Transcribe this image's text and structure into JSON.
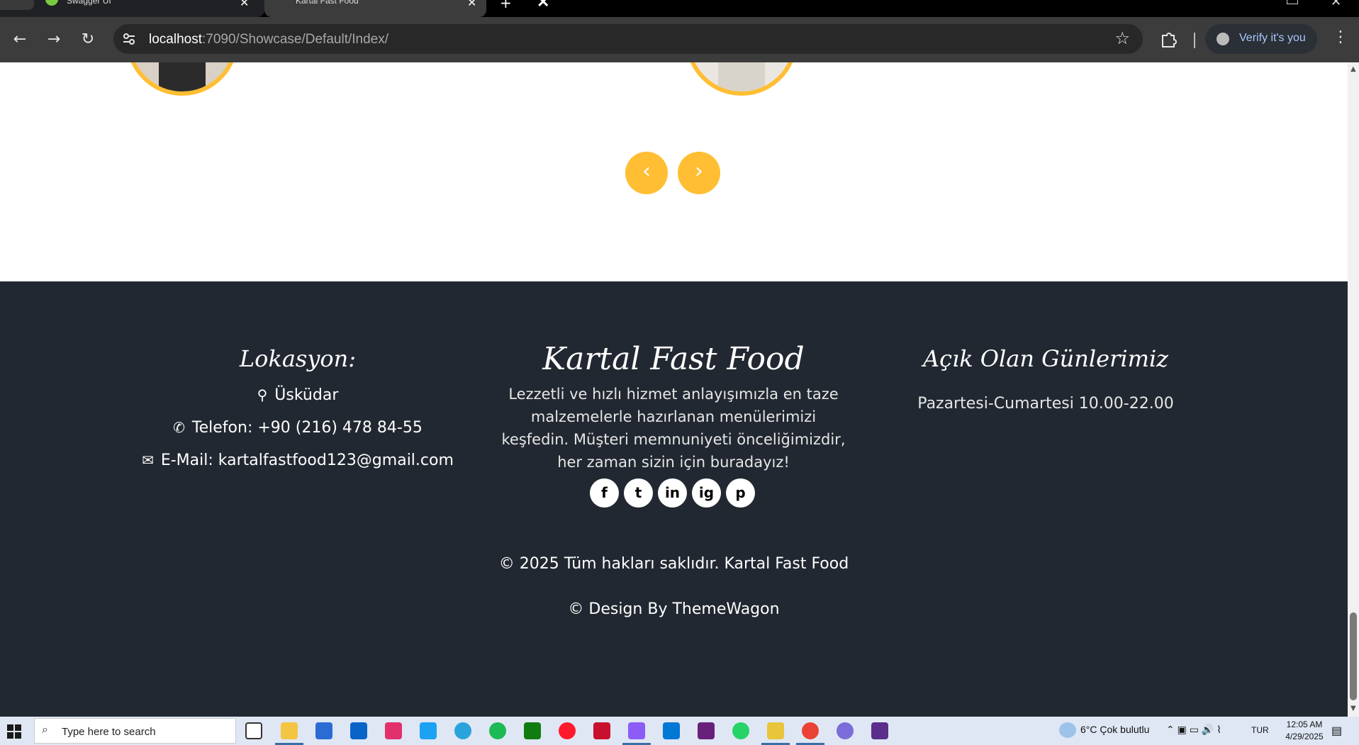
{
  "browser": {
    "tabs": [
      {
        "title": "Swagger UI",
        "icon": "swagger-icon"
      },
      {
        "title": "Kartal Fast Food",
        "icon": "x-logo-icon"
      }
    ],
    "url_host": "localhost",
    "url_path": ":7090/Showcase/Default/Index/",
    "profile_label": "Verify it's you"
  },
  "carousel": {
    "prev_label": "‹",
    "next_label": "›"
  },
  "footer": {
    "location": {
      "heading": "Lokasyon:",
      "address": "Üsküdar",
      "phone": "Telefon: +90 (216) 478 84-55",
      "email": "E-Mail: kartalfastfood123@gmail.com"
    },
    "brand": {
      "heading": "Kartal Fast Food",
      "description": "Lezzetli ve hızlı hizmet anlayışımızla en taze malzemelerle hazırlanan menülerimizi keşfedin. Müşteri memnuniyeti önceliğimizdir, her zaman sizin için buradayız!",
      "social": [
        "f",
        "t",
        "in",
        "ig",
        "p"
      ]
    },
    "hours": {
      "heading": "Açık Olan Günlerimiz",
      "text": "Pazartesi-Cumartesi 10.00-22.00"
    },
    "copyright": "© 2025 Tüm hakları saklıdır. Kartal Fast Food",
    "credit": "© Design By ThemeWagon"
  },
  "taskbar": {
    "search_placeholder": "Type here to search",
    "weather": "6°C  Çok bulutlu",
    "language": "TUR",
    "time": "12:05 AM",
    "date": "4/29/2025"
  },
  "colors": {
    "accent": "#ffbe33",
    "footer_bg": "#222831"
  }
}
